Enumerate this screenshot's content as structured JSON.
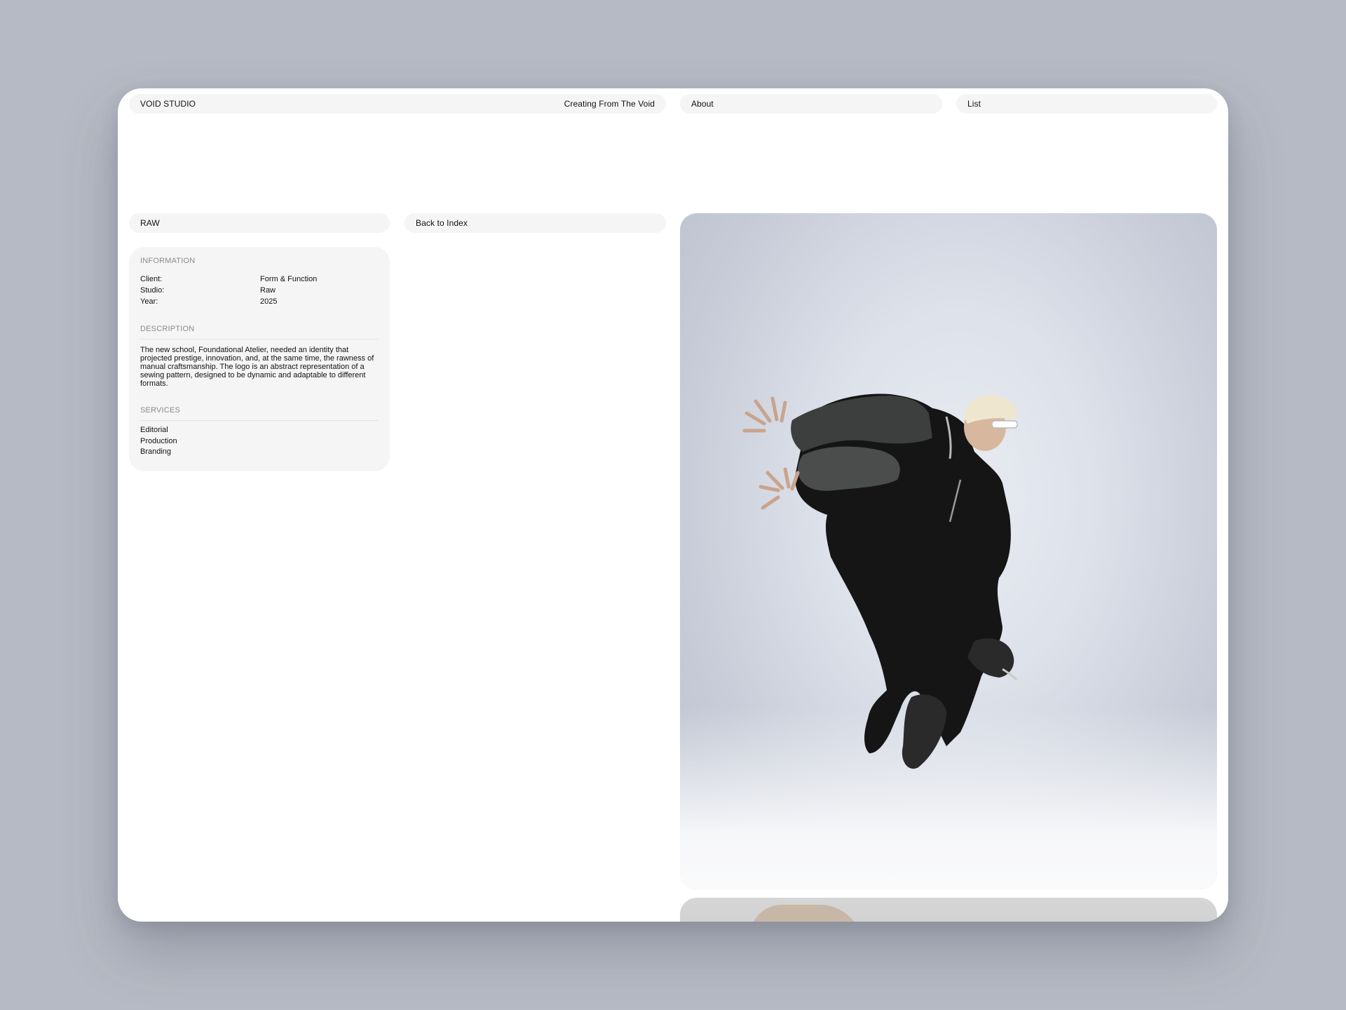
{
  "header": {
    "brand": "VOID STUDIO",
    "tagline": "Creating From The Void",
    "about_label": "About",
    "list_label": "List"
  },
  "project": {
    "name": "RAW",
    "back_label": "Back to Index"
  },
  "information": {
    "title": "INFORMATION",
    "rows": [
      {
        "label": "Client:",
        "value": "Form & Function"
      },
      {
        "label": "Studio:",
        "value": "Raw"
      },
      {
        "label": "Year:",
        "value": "2025"
      }
    ]
  },
  "description": {
    "title": "DESCRIPTION",
    "text": "The new school, Foundational Atelier, needed an identity that projected prestige, innovation, and, at the same time, the rawness of manual craftsmanship. The logo is an abstract representation of a sewing pattern, designed to be dynamic and adaptable to different formats."
  },
  "services": {
    "title": "SERVICES",
    "items": [
      "Editorial",
      "Production",
      "Branding"
    ]
  },
  "colors": {
    "page_bg": "#b6bac4",
    "panel_bg": "#f5f5f5",
    "frame_bg": "#ffffff"
  }
}
